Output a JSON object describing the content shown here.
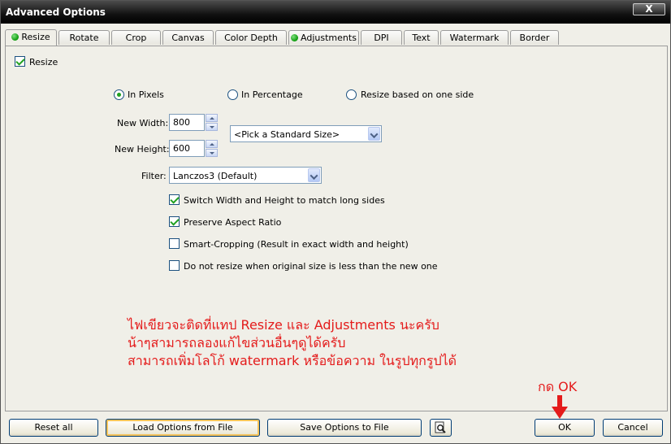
{
  "window": {
    "title": "Advanced Options",
    "close_label": "X"
  },
  "tabs": [
    {
      "label": "Resize",
      "active": true,
      "indicator": true
    },
    {
      "label": "Rotate",
      "active": false,
      "indicator": false
    },
    {
      "label": "Crop",
      "active": false,
      "indicator": false
    },
    {
      "label": "Canvas",
      "active": false,
      "indicator": false
    },
    {
      "label": "Color Depth",
      "active": false,
      "indicator": false
    },
    {
      "label": "Adjustments",
      "active": false,
      "indicator": true
    },
    {
      "label": "DPI",
      "active": false,
      "indicator": false
    },
    {
      "label": "Text",
      "active": false,
      "indicator": false
    },
    {
      "label": "Watermark",
      "active": false,
      "indicator": false
    },
    {
      "label": "Border",
      "active": false,
      "indicator": false
    }
  ],
  "resize": {
    "enable_label": "Resize",
    "enable_checked": true,
    "mode_options": [
      {
        "label": "In Pixels",
        "selected": true
      },
      {
        "label": "In Percentage",
        "selected": false
      },
      {
        "label": "Resize based on one side",
        "selected": false
      }
    ],
    "width_label": "New Width:",
    "width_value": "800",
    "height_label": "New Height:",
    "height_value": "600",
    "standard_size": "<Pick a Standard Size>",
    "filter_label": "Filter:",
    "filter_value": "Lanczos3 (Default)",
    "options": [
      {
        "label": "Switch Width and Height to match long sides",
        "checked": true
      },
      {
        "label": "Preserve Aspect Ratio",
        "checked": true
      },
      {
        "label": "Smart-Cropping (Result in exact width and height)",
        "checked": false
      },
      {
        "label": "Do not resize when original size is less than the new one",
        "checked": false
      }
    ]
  },
  "annotation": {
    "lines": [
      "ไฟเขียวจะติดที่แทป Resize และ Adjustments นะครับ",
      "น้าๆสามารถลองแก้ไขส่วนอื่นๆดูได้ครับ",
      "สามารถเพิ่มโลโก้ watermark หรือข้อความ ในรูปทุกรูปได้"
    ],
    "ok_hint": "กด OK",
    "color": "#e41b1b"
  },
  "footer": {
    "reset_label": "Reset all",
    "load_label": "Load Options from File",
    "save_label": "Save Options to File",
    "preview_icon": "magnifier-page-icon",
    "ok_label": "OK",
    "cancel_label": "Cancel"
  },
  "colors": {
    "indicator": "#0a9a0a",
    "check": "#21a121",
    "title_bar": "#111111"
  }
}
